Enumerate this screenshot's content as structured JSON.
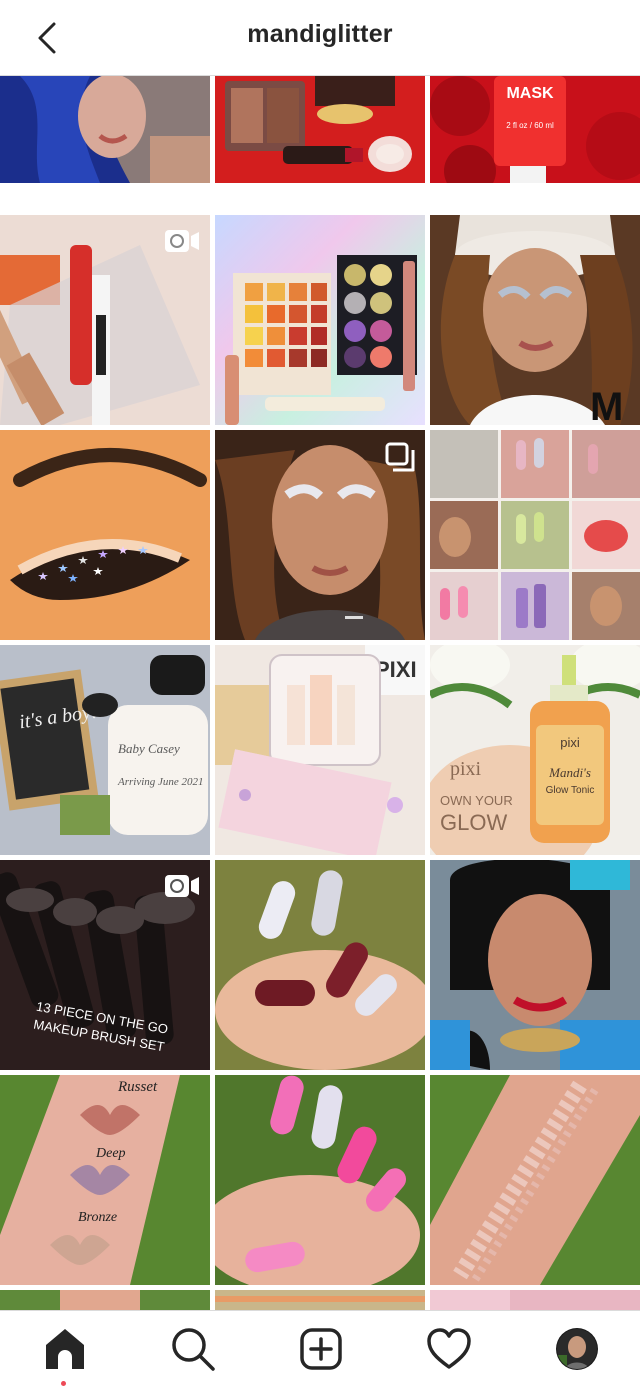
{
  "header": {
    "username": "mandiglitter",
    "back_icon": "chevron-left-icon"
  },
  "posts": [
    {
      "row": 0,
      "col": 0,
      "subject": "selfie with blue hair",
      "kind": "photo"
    },
    {
      "row": 0,
      "col": 1,
      "subject": "red lipstick and bronzer flatlay",
      "kind": "photo"
    },
    {
      "row": 0,
      "col": 2,
      "subject": "probiotic mask on rose petals",
      "kind": "photo",
      "texts": [
        "MASK",
        "2 fl oz / 60 ml"
      ]
    },
    {
      "row": 1,
      "col": 0,
      "subject": "lip gloss products",
      "kind": "video",
      "badge_icon": "video-camera-icon"
    },
    {
      "row": 1,
      "col": 1,
      "subject": "eyeshadow palettes on holographic background",
      "kind": "photo"
    },
    {
      "row": 1,
      "col": 2,
      "subject": "selfie with white beanie",
      "kind": "photo"
    },
    {
      "row": 2,
      "col": 0,
      "subject": "star glitter eye makeup closeup",
      "kind": "photo"
    },
    {
      "row": 2,
      "col": 1,
      "subject": "glitter eye makeup selfie",
      "kind": "carousel",
      "badge_icon": "multiple-images-icon"
    },
    {
      "row": 2,
      "col": 2,
      "subject": "nails collage grid",
      "kind": "photo"
    },
    {
      "row": 3,
      "col": 0,
      "subject": "baby announcement flatlay",
      "kind": "photo",
      "texts": [
        "it's a boy!",
        "Baby Casey",
        "Arriving June 2021"
      ]
    },
    {
      "row": 3,
      "col": 1,
      "subject": "Pixi gift set",
      "kind": "photo",
      "texts": [
        "PIXI"
      ]
    },
    {
      "row": 3,
      "col": 2,
      "subject": "Pixi Glow Tonic bottle",
      "kind": "photo",
      "texts": [
        "pixi",
        "OWN YOUR",
        "GLOW",
        "pixi",
        "Mandi's",
        "Glow Tonic"
      ]
    },
    {
      "row": 4,
      "col": 0,
      "subject": "makeup brush set",
      "kind": "video",
      "badge_icon": "video-camera-icon",
      "texts": [
        "13 PIECE ON THE GO",
        "MAKEUP BRUSH SET"
      ]
    },
    {
      "row": 4,
      "col": 1,
      "subject": "chrome and burgundy nails",
      "kind": "photo"
    },
    {
      "row": 4,
      "col": 2,
      "subject": "princess costume selfie",
      "kind": "photo"
    },
    {
      "row": 5,
      "col": 0,
      "subject": "butterfly swatches on arm",
      "kind": "photo",
      "texts": [
        "Russet",
        "Deep",
        "Bronze"
      ]
    },
    {
      "row": 5,
      "col": 1,
      "subject": "pink chrome nails",
      "kind": "photo"
    },
    {
      "row": 5,
      "col": 2,
      "subject": "glitter swatch on arm",
      "kind": "photo"
    },
    {
      "row": 6,
      "col": 0,
      "subject": "partial post",
      "kind": "photo"
    },
    {
      "row": 6,
      "col": 1,
      "subject": "partial post",
      "kind": "photo"
    },
    {
      "row": 6,
      "col": 2,
      "subject": "partial post",
      "kind": "photo"
    }
  ],
  "tabbar": {
    "items": [
      {
        "icon": "home-icon",
        "active": true,
        "notification_dot": true
      },
      {
        "icon": "search-icon",
        "active": false
      },
      {
        "icon": "new-post-icon",
        "active": false
      },
      {
        "icon": "activity-heart-icon",
        "active": false
      },
      {
        "icon": "profile-avatar-icon",
        "active": false
      }
    ]
  },
  "colors": {
    "text": "#262626",
    "divider": "#dbdbdb",
    "notification": "#ed4956"
  }
}
